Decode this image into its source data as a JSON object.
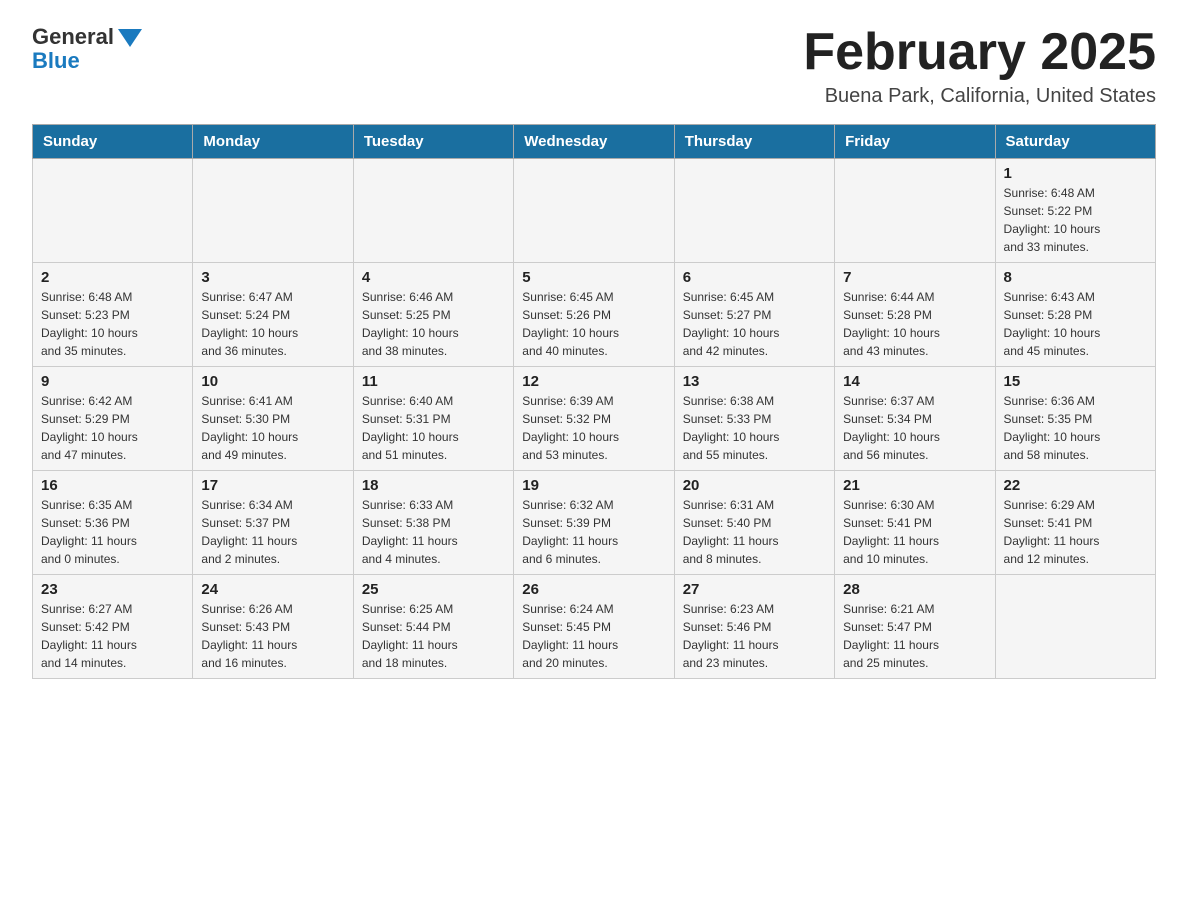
{
  "header": {
    "logo_general": "General",
    "logo_blue": "Blue",
    "month_title": "February 2025",
    "location": "Buena Park, California, United States"
  },
  "weekdays": [
    "Sunday",
    "Monday",
    "Tuesday",
    "Wednesday",
    "Thursday",
    "Friday",
    "Saturday"
  ],
  "weeks": [
    [
      {
        "day": "",
        "info": ""
      },
      {
        "day": "",
        "info": ""
      },
      {
        "day": "",
        "info": ""
      },
      {
        "day": "",
        "info": ""
      },
      {
        "day": "",
        "info": ""
      },
      {
        "day": "",
        "info": ""
      },
      {
        "day": "1",
        "info": "Sunrise: 6:48 AM\nSunset: 5:22 PM\nDaylight: 10 hours\nand 33 minutes."
      }
    ],
    [
      {
        "day": "2",
        "info": "Sunrise: 6:48 AM\nSunset: 5:23 PM\nDaylight: 10 hours\nand 35 minutes."
      },
      {
        "day": "3",
        "info": "Sunrise: 6:47 AM\nSunset: 5:24 PM\nDaylight: 10 hours\nand 36 minutes."
      },
      {
        "day": "4",
        "info": "Sunrise: 6:46 AM\nSunset: 5:25 PM\nDaylight: 10 hours\nand 38 minutes."
      },
      {
        "day": "5",
        "info": "Sunrise: 6:45 AM\nSunset: 5:26 PM\nDaylight: 10 hours\nand 40 minutes."
      },
      {
        "day": "6",
        "info": "Sunrise: 6:45 AM\nSunset: 5:27 PM\nDaylight: 10 hours\nand 42 minutes."
      },
      {
        "day": "7",
        "info": "Sunrise: 6:44 AM\nSunset: 5:28 PM\nDaylight: 10 hours\nand 43 minutes."
      },
      {
        "day": "8",
        "info": "Sunrise: 6:43 AM\nSunset: 5:28 PM\nDaylight: 10 hours\nand 45 minutes."
      }
    ],
    [
      {
        "day": "9",
        "info": "Sunrise: 6:42 AM\nSunset: 5:29 PM\nDaylight: 10 hours\nand 47 minutes."
      },
      {
        "day": "10",
        "info": "Sunrise: 6:41 AM\nSunset: 5:30 PM\nDaylight: 10 hours\nand 49 minutes."
      },
      {
        "day": "11",
        "info": "Sunrise: 6:40 AM\nSunset: 5:31 PM\nDaylight: 10 hours\nand 51 minutes."
      },
      {
        "day": "12",
        "info": "Sunrise: 6:39 AM\nSunset: 5:32 PM\nDaylight: 10 hours\nand 53 minutes."
      },
      {
        "day": "13",
        "info": "Sunrise: 6:38 AM\nSunset: 5:33 PM\nDaylight: 10 hours\nand 55 minutes."
      },
      {
        "day": "14",
        "info": "Sunrise: 6:37 AM\nSunset: 5:34 PM\nDaylight: 10 hours\nand 56 minutes."
      },
      {
        "day": "15",
        "info": "Sunrise: 6:36 AM\nSunset: 5:35 PM\nDaylight: 10 hours\nand 58 minutes."
      }
    ],
    [
      {
        "day": "16",
        "info": "Sunrise: 6:35 AM\nSunset: 5:36 PM\nDaylight: 11 hours\nand 0 minutes."
      },
      {
        "day": "17",
        "info": "Sunrise: 6:34 AM\nSunset: 5:37 PM\nDaylight: 11 hours\nand 2 minutes."
      },
      {
        "day": "18",
        "info": "Sunrise: 6:33 AM\nSunset: 5:38 PM\nDaylight: 11 hours\nand 4 minutes."
      },
      {
        "day": "19",
        "info": "Sunrise: 6:32 AM\nSunset: 5:39 PM\nDaylight: 11 hours\nand 6 minutes."
      },
      {
        "day": "20",
        "info": "Sunrise: 6:31 AM\nSunset: 5:40 PM\nDaylight: 11 hours\nand 8 minutes."
      },
      {
        "day": "21",
        "info": "Sunrise: 6:30 AM\nSunset: 5:41 PM\nDaylight: 11 hours\nand 10 minutes."
      },
      {
        "day": "22",
        "info": "Sunrise: 6:29 AM\nSunset: 5:41 PM\nDaylight: 11 hours\nand 12 minutes."
      }
    ],
    [
      {
        "day": "23",
        "info": "Sunrise: 6:27 AM\nSunset: 5:42 PM\nDaylight: 11 hours\nand 14 minutes."
      },
      {
        "day": "24",
        "info": "Sunrise: 6:26 AM\nSunset: 5:43 PM\nDaylight: 11 hours\nand 16 minutes."
      },
      {
        "day": "25",
        "info": "Sunrise: 6:25 AM\nSunset: 5:44 PM\nDaylight: 11 hours\nand 18 minutes."
      },
      {
        "day": "26",
        "info": "Sunrise: 6:24 AM\nSunset: 5:45 PM\nDaylight: 11 hours\nand 20 minutes."
      },
      {
        "day": "27",
        "info": "Sunrise: 6:23 AM\nSunset: 5:46 PM\nDaylight: 11 hours\nand 23 minutes."
      },
      {
        "day": "28",
        "info": "Sunrise: 6:21 AM\nSunset: 5:47 PM\nDaylight: 11 hours\nand 25 minutes."
      },
      {
        "day": "",
        "info": ""
      }
    ]
  ]
}
